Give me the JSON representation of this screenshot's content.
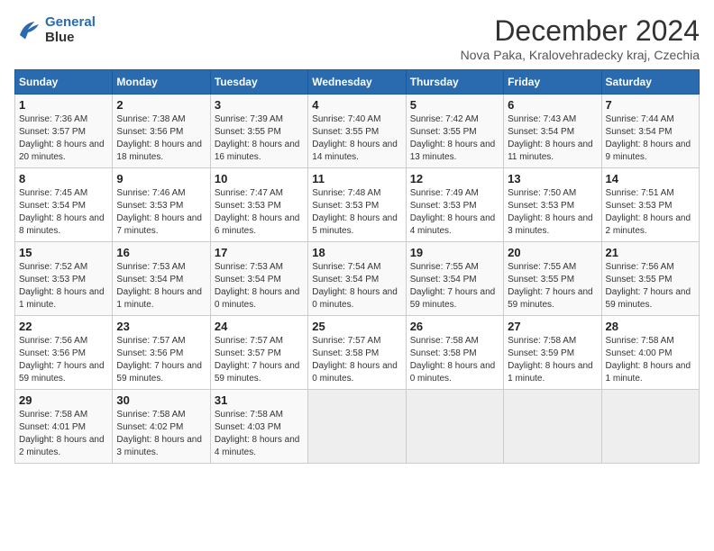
{
  "header": {
    "logo_line1": "General",
    "logo_line2": "Blue",
    "title": "December 2024",
    "subtitle": "Nova Paka, Kralovehradecky kraj, Czechia"
  },
  "calendar": {
    "days_of_week": [
      "Sunday",
      "Monday",
      "Tuesday",
      "Wednesday",
      "Thursday",
      "Friday",
      "Saturday"
    ],
    "weeks": [
      [
        null,
        {
          "day": "2",
          "sunrise": "7:38 AM",
          "sunset": "3:56 PM",
          "daylight": "8 hours and 18 minutes."
        },
        {
          "day": "3",
          "sunrise": "7:39 AM",
          "sunset": "3:55 PM",
          "daylight": "8 hours and 16 minutes."
        },
        {
          "day": "4",
          "sunrise": "7:40 AM",
          "sunset": "3:55 PM",
          "daylight": "8 hours and 14 minutes."
        },
        {
          "day": "5",
          "sunrise": "7:42 AM",
          "sunset": "3:55 PM",
          "daylight": "8 hours and 13 minutes."
        },
        {
          "day": "6",
          "sunrise": "7:43 AM",
          "sunset": "3:54 PM",
          "daylight": "8 hours and 11 minutes."
        },
        {
          "day": "7",
          "sunrise": "7:44 AM",
          "sunset": "3:54 PM",
          "daylight": "8 hours and 9 minutes."
        }
      ],
      [
        {
          "day": "1",
          "sunrise": "7:36 AM",
          "sunset": "3:57 PM",
          "daylight": "8 hours and 20 minutes."
        },
        {
          "day": "8",
          "sunrise": "7:45 AM",
          "sunset": "3:54 PM",
          "daylight": "8 hours and 8 minutes."
        },
        {
          "day": "9",
          "sunrise": "7:46 AM",
          "sunset": "3:53 PM",
          "daylight": "8 hours and 7 minutes."
        },
        {
          "day": "10",
          "sunrise": "7:47 AM",
          "sunset": "3:53 PM",
          "daylight": "8 hours and 6 minutes."
        },
        {
          "day": "11",
          "sunrise": "7:48 AM",
          "sunset": "3:53 PM",
          "daylight": "8 hours and 5 minutes."
        },
        {
          "day": "12",
          "sunrise": "7:49 AM",
          "sunset": "3:53 PM",
          "daylight": "8 hours and 4 minutes."
        },
        {
          "day": "13",
          "sunrise": "7:50 AM",
          "sunset": "3:53 PM",
          "daylight": "8 hours and 3 minutes."
        },
        {
          "day": "14",
          "sunrise": "7:51 AM",
          "sunset": "3:53 PM",
          "daylight": "8 hours and 2 minutes."
        }
      ],
      [
        {
          "day": "15",
          "sunrise": "7:52 AM",
          "sunset": "3:53 PM",
          "daylight": "8 hours and 1 minute."
        },
        {
          "day": "16",
          "sunrise": "7:53 AM",
          "sunset": "3:54 PM",
          "daylight": "8 hours and 1 minute."
        },
        {
          "day": "17",
          "sunrise": "7:53 AM",
          "sunset": "3:54 PM",
          "daylight": "8 hours and 0 minutes."
        },
        {
          "day": "18",
          "sunrise": "7:54 AM",
          "sunset": "3:54 PM",
          "daylight": "8 hours and 0 minutes."
        },
        {
          "day": "19",
          "sunrise": "7:55 AM",
          "sunset": "3:54 PM",
          "daylight": "7 hours and 59 minutes."
        },
        {
          "day": "20",
          "sunrise": "7:55 AM",
          "sunset": "3:55 PM",
          "daylight": "7 hours and 59 minutes."
        },
        {
          "day": "21",
          "sunrise": "7:56 AM",
          "sunset": "3:55 PM",
          "daylight": "7 hours and 59 minutes."
        }
      ],
      [
        {
          "day": "22",
          "sunrise": "7:56 AM",
          "sunset": "3:56 PM",
          "daylight": "7 hours and 59 minutes."
        },
        {
          "day": "23",
          "sunrise": "7:57 AM",
          "sunset": "3:56 PM",
          "daylight": "7 hours and 59 minutes."
        },
        {
          "day": "24",
          "sunrise": "7:57 AM",
          "sunset": "3:57 PM",
          "daylight": "7 hours and 59 minutes."
        },
        {
          "day": "25",
          "sunrise": "7:57 AM",
          "sunset": "3:58 PM",
          "daylight": "8 hours and 0 minutes."
        },
        {
          "day": "26",
          "sunrise": "7:58 AM",
          "sunset": "3:58 PM",
          "daylight": "8 hours and 0 minutes."
        },
        {
          "day": "27",
          "sunrise": "7:58 AM",
          "sunset": "3:59 PM",
          "daylight": "8 hours and 1 minute."
        },
        {
          "day": "28",
          "sunrise": "7:58 AM",
          "sunset": "4:00 PM",
          "daylight": "8 hours and 1 minute."
        }
      ],
      [
        {
          "day": "29",
          "sunrise": "7:58 AM",
          "sunset": "4:01 PM",
          "daylight": "8 hours and 2 minutes."
        },
        {
          "day": "30",
          "sunrise": "7:58 AM",
          "sunset": "4:02 PM",
          "daylight": "8 hours and 3 minutes."
        },
        {
          "day": "31",
          "sunrise": "7:58 AM",
          "sunset": "4:03 PM",
          "daylight": "8 hours and 4 minutes."
        },
        null,
        null,
        null,
        null
      ]
    ]
  }
}
